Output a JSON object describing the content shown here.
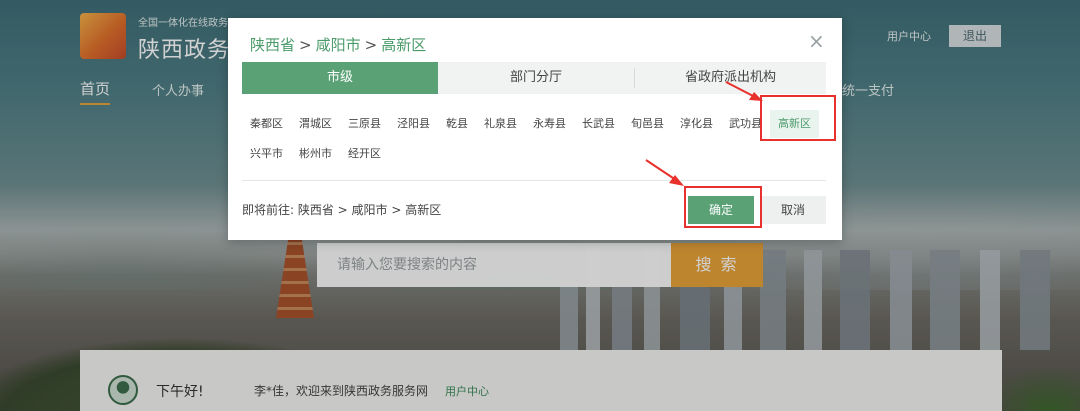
{
  "background": {
    "brand_small": "全国一体化在线政务",
    "brand_big": "陕西政务服",
    "user_center": "用户中心",
    "logout": "退出",
    "nav": {
      "home": "首页",
      "personal": "个人办事",
      "unified": "统一支付"
    },
    "search_placeholder": "请输入您要搜索的内容",
    "search_button": "搜 索",
    "welcome": {
      "greeting": "下午好!",
      "text": "李*佳，欢迎来到陕西政务服务网",
      "user_center": "用户中心"
    }
  },
  "modal": {
    "breadcrumb": [
      "陕西省",
      "咸阳市",
      "高新区"
    ],
    "breadcrumb_sep": ">",
    "close": "×",
    "tabs": [
      {
        "label": "市级",
        "active": true
      },
      {
        "label": "部门分厅",
        "active": false
      },
      {
        "label": "省政府派出机构",
        "active": false
      }
    ],
    "districts_row1": [
      "秦都区",
      "渭城区",
      "三原县",
      "泾阳县",
      "乾县",
      "礼泉县",
      "永寿县",
      "长武县",
      "旬邑县",
      "淳化县",
      "武功县",
      "高新区"
    ],
    "districts_row2": [
      "兴平市",
      "彬州市",
      "经开区"
    ],
    "selected_district": "高新区",
    "going_label": "即将前往: 陕西省 > 咸阳市 > 高新区",
    "confirm": "确定",
    "cancel": "取消"
  },
  "colors": {
    "accent": "#5aa275",
    "annotation": "#e8312c",
    "search_button": "#e8a33a"
  }
}
